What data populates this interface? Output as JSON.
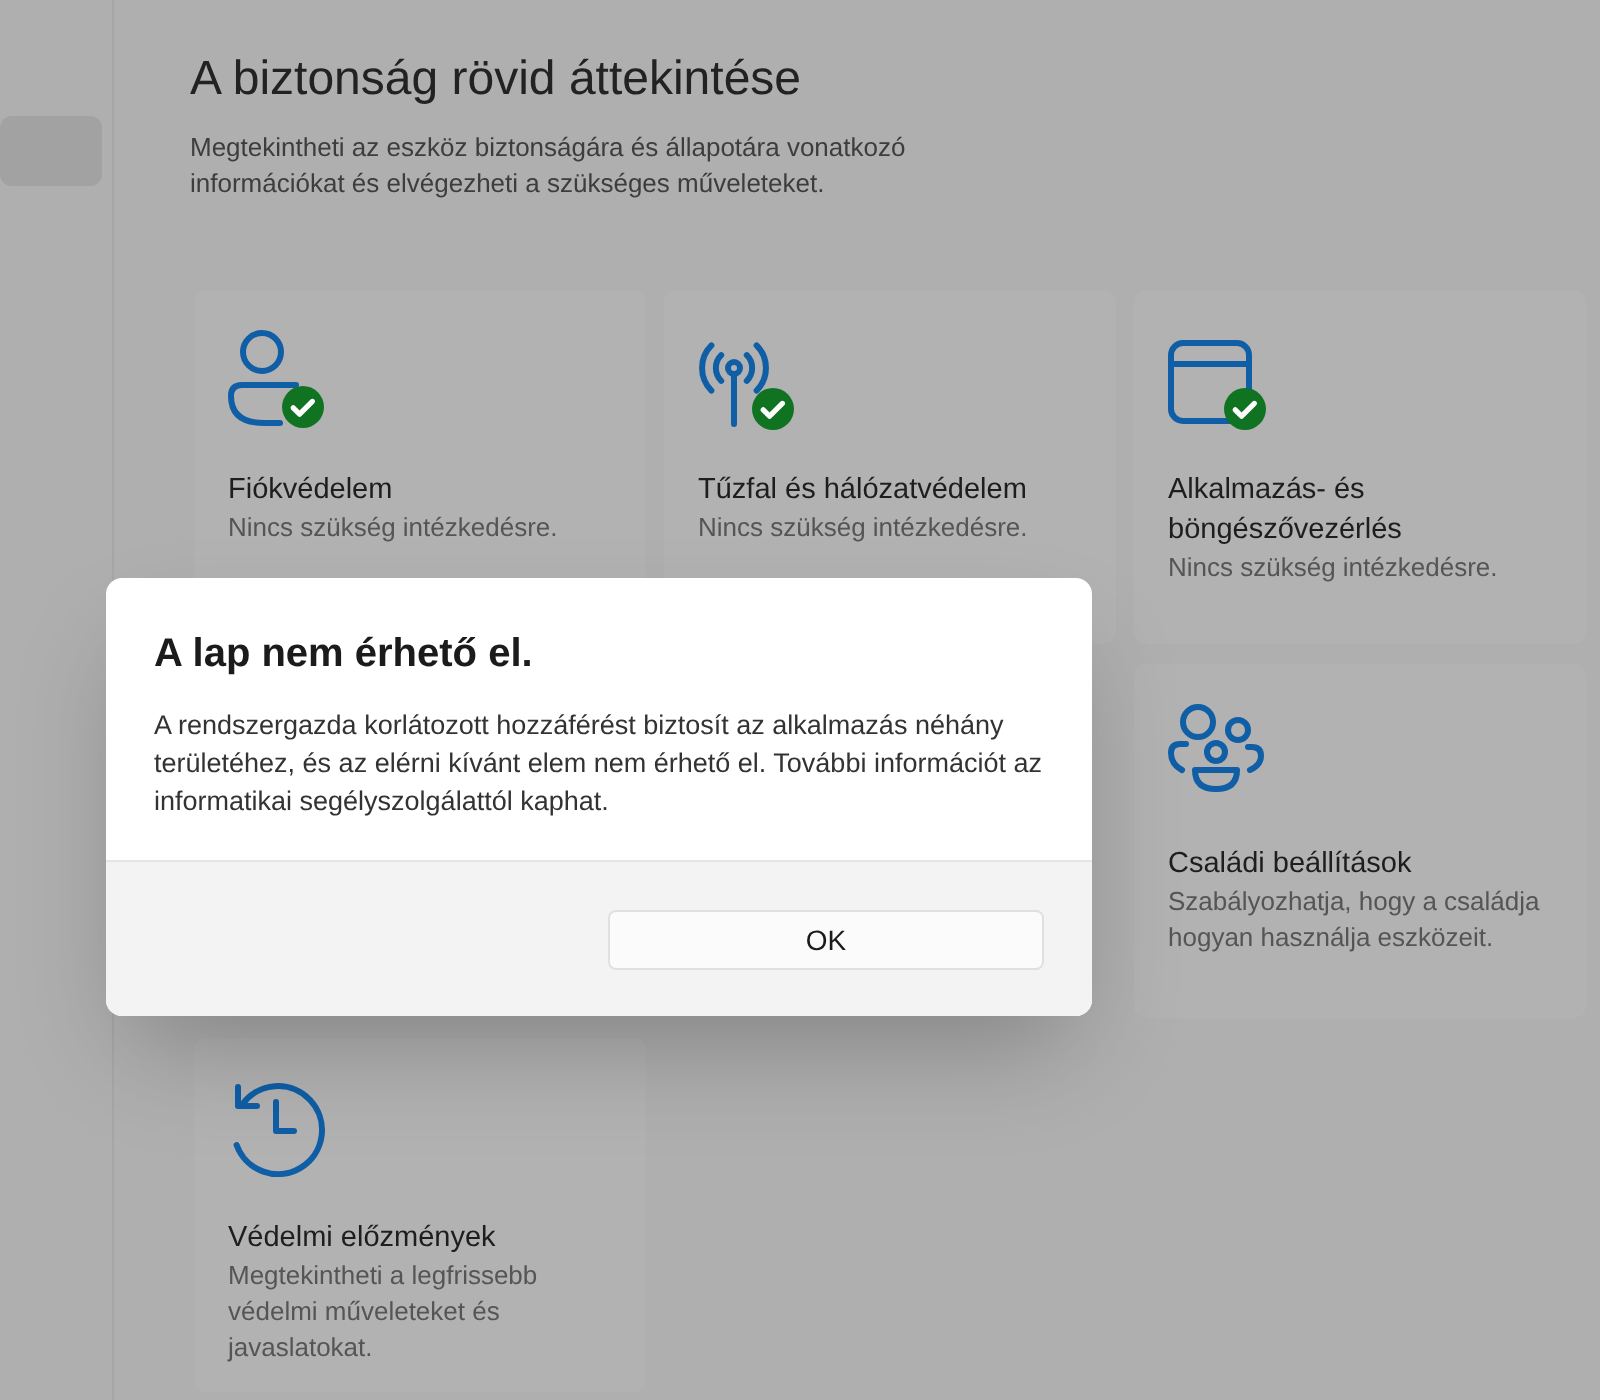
{
  "sidebar": {
    "items": [
      {
        "selected": true
      }
    ]
  },
  "page": {
    "title": "A biztonság rövid áttekintése",
    "description": "Megtekintheti az eszköz biztonságára és állapotára vonatkozó információkat és elvégezheti a szükséges műveleteket."
  },
  "tiles": [
    {
      "kind": "account",
      "title": "Fiókvédelem",
      "subtitle": "Nincs szükség intézkedésre.",
      "ok": true
    },
    {
      "kind": "network",
      "title": "Tűzfal és hálózatvédelem",
      "subtitle": "Nincs szükség intézkedésre.",
      "ok": true
    },
    {
      "kind": "app",
      "title": "Alkalmazás- és böngészővezérlés",
      "subtitle": "Nincs szükség intézkedésre.",
      "ok": true
    },
    {
      "kind": "family",
      "title": "Családi beállítások",
      "subtitle": "Szabályozhatja, hogy a családja hogyan használja eszközeit.",
      "ok": false
    },
    {
      "kind": "history",
      "title": "Védelmi előzmények",
      "subtitle": "Megtekintheti a legfrissebb védelmi műveleteket és javaslatokat.",
      "ok": false
    }
  ],
  "dialog": {
    "title": "A lap nem érhető el.",
    "message": "A rendszergazda korlátozott hozzáférést biztosít az alkalmazás néhány területéhez, és az elérni kívánt elem nem érhető el. További információt az informatikai segélyszolgálattól kaphat.",
    "buttons": [
      "OK"
    ]
  }
}
